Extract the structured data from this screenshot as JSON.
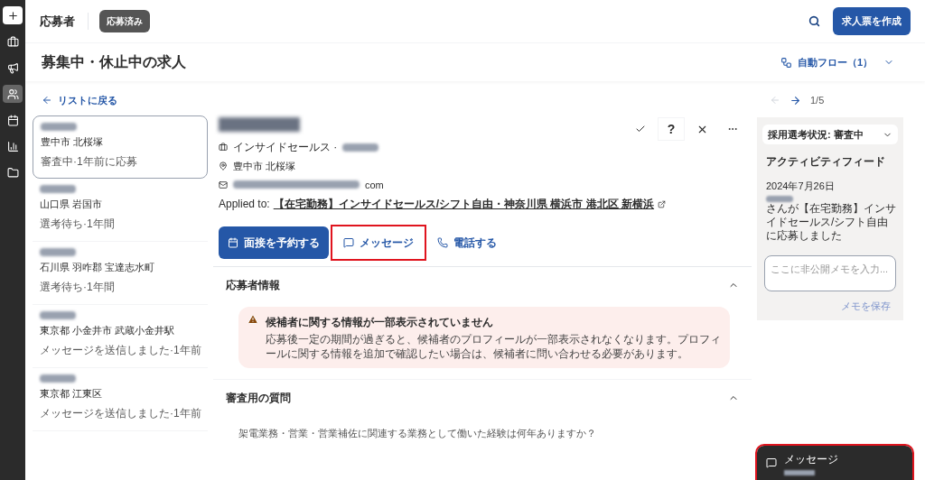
{
  "nav_items": [
    {
      "kind": "jobs",
      "selected": false
    },
    {
      "kind": "campaign",
      "selected": false
    },
    {
      "kind": "people",
      "selected": true
    },
    {
      "kind": "calendar",
      "selected": false
    },
    {
      "kind": "chart",
      "selected": false
    },
    {
      "kind": "folder",
      "selected": false
    }
  ],
  "header": {
    "title": "応募者",
    "status_badge": "応募済み",
    "create_button": "求人票を作成"
  },
  "page_title": "募集中・休止中の求人",
  "auto_flow": "自動フロー（1）",
  "back_link": "リストに戻る",
  "pager": {
    "prev_disabled": true,
    "count": "1/5"
  },
  "maybe_label": "?",
  "candidates": [
    {
      "location": "豊中市 北桜塚",
      "status": "審査中·1年前に応募",
      "selected": true
    },
    {
      "location": "山口県 岩国市",
      "status": "選考待ち·1年間",
      "selected": false
    },
    {
      "location": "石川県 羽咋郡 宝達志水町",
      "status": "選考待ち·1年間",
      "selected": false
    },
    {
      "location": "東京都 小金井市 武蔵小金井駅",
      "status": "メッセージを送信しました·1年前",
      "selected": false
    },
    {
      "location": "東京都 江東区",
      "status": "メッセージを送信しました·1年前",
      "selected": false
    }
  ],
  "profile": {
    "job_line": "インサイドセールス ·",
    "location": "豊中市 北桜塚",
    "email_suffix": "com",
    "applied_label": "Applied to:",
    "applied_job": "【在宅勤務】インサイドセールス/シフト自由・神奈川県 横浜市 港北区 新横浜"
  },
  "actions": [
    {
      "label": "面接を予約する",
      "kind": "primary",
      "highlighted": false
    },
    {
      "label": "メッセージ",
      "kind": "message",
      "highlighted": true
    },
    {
      "label": "電話する",
      "kind": "phone",
      "highlighted": false
    }
  ],
  "sections": [
    {
      "title": "応募者情報",
      "expanded": true
    },
    {
      "title": "審査用の質問",
      "expanded": true
    }
  ],
  "notice": {
    "title": "候補者に関する情報が一部表示されていません",
    "body": "応募後一定の期間が過ぎると、候補者のプロフィールが一部表示されなくなります。プロフィールに関する情報を追加で確認したい場合は、候補者に問い合わせる必要があります。"
  },
  "question": "架電業務・営業・営業補佐に関連する業務として働いた経験は何年ありますか？",
  "status_select": "採用選考状況: 審査中",
  "activity": {
    "title": "アクティビティフィード",
    "date": "2024年7月26日",
    "text": "さんが【在宅勤務】インサイドセールス/シフト自由に応募しました"
  },
  "memo": {
    "placeholder": "ここに非公開メモを入力...",
    "save": "メモを保存"
  },
  "message_popup": {
    "title": "メッセージ",
    "highlighted": true
  }
}
